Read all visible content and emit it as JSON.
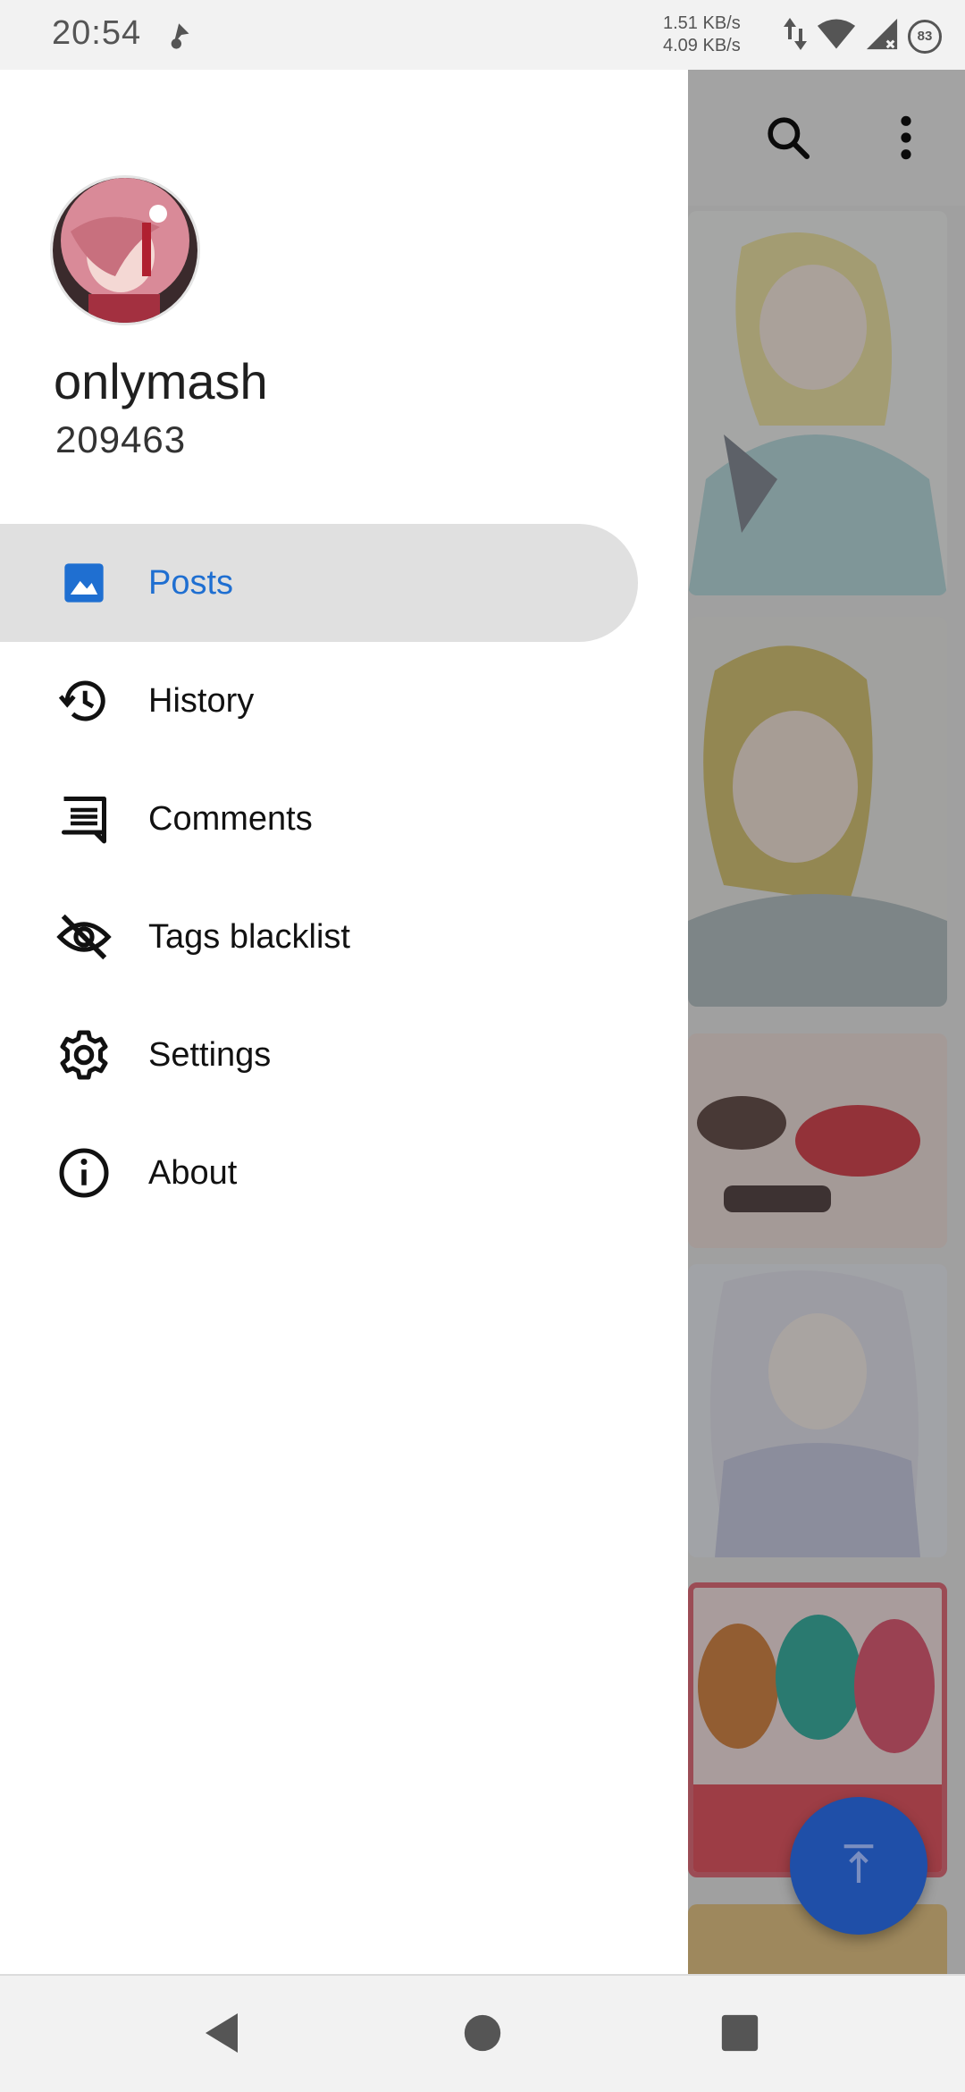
{
  "status_bar": {
    "time": "20:54",
    "net_up": "1.51 KB/s",
    "net_down": "4.09 KB/s",
    "battery": "83",
    "icons": [
      "navigation-icon",
      "data-transfer-icon",
      "wifi-icon",
      "cell-signal-icon",
      "battery-icon"
    ]
  },
  "drawer": {
    "username": "onlymash",
    "user_id": "209463",
    "menu": [
      {
        "label": "Posts",
        "icon": "image-icon",
        "active": true
      },
      {
        "label": "History",
        "icon": "history-icon",
        "active": false
      },
      {
        "label": "Comments",
        "icon": "comment-icon",
        "active": false
      },
      {
        "label": "Tags blacklist",
        "icon": "eye-off-icon",
        "active": false
      },
      {
        "label": "Settings",
        "icon": "gear-icon",
        "active": false
      },
      {
        "label": "About",
        "icon": "info-icon",
        "active": false
      }
    ]
  },
  "toolbar": {
    "icons": [
      "search-icon",
      "more-vert-icon"
    ]
  },
  "fab": {
    "icon": "scroll-to-top-icon"
  },
  "nav_bar": {
    "icons": [
      "back-icon",
      "home-icon",
      "recents-icon"
    ]
  },
  "colors": {
    "accent": "#1f6fd1",
    "fab": "#1f4fa8",
    "active_item_bg": "#e0e0e0"
  }
}
